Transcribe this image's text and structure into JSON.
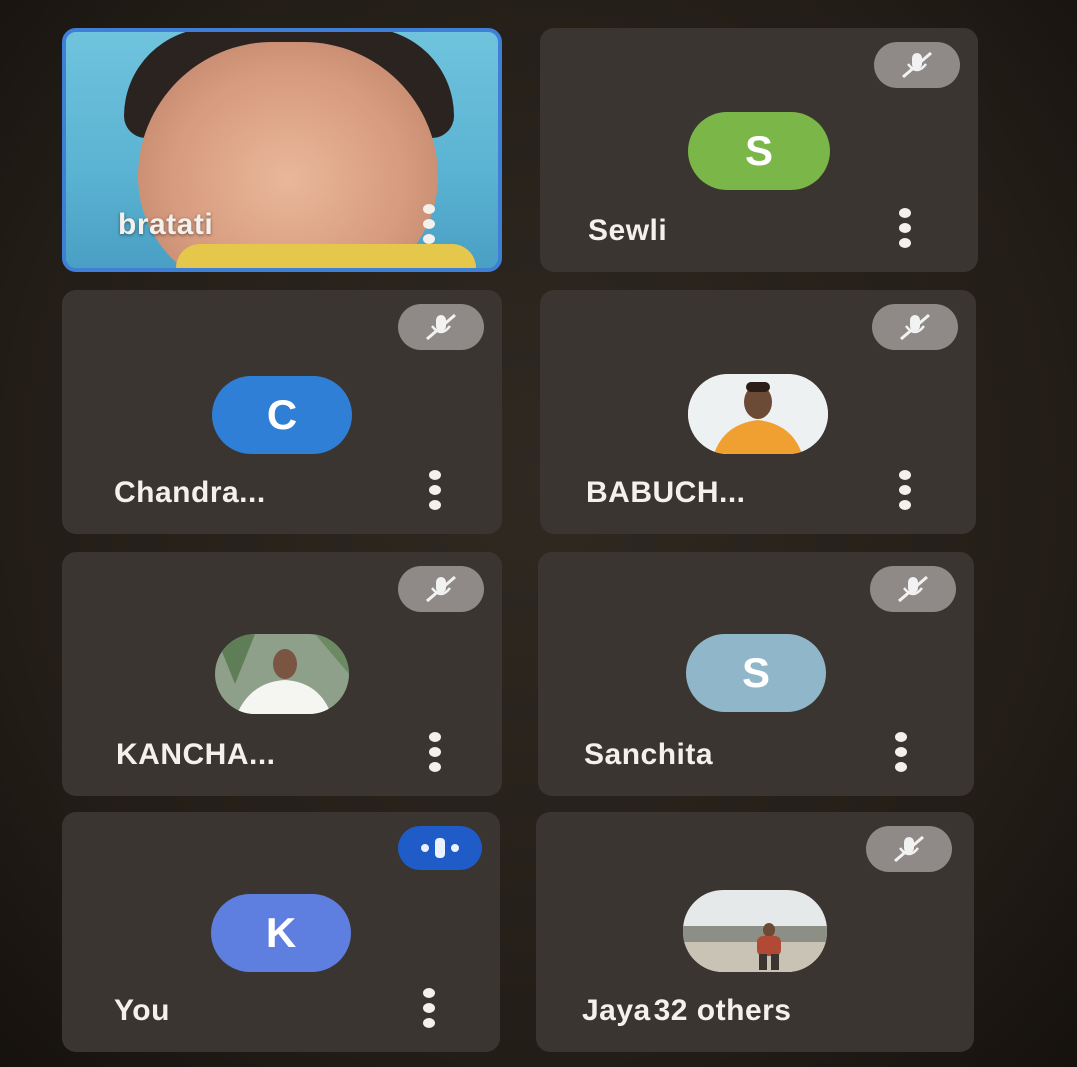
{
  "participants": [
    {
      "name": "bratati",
      "state": "video",
      "avatar_initial": ""
    },
    {
      "name": "Sewli",
      "state": "muted",
      "avatar_initial": "S",
      "avatar_color": "#7ab648"
    },
    {
      "name": "Chandra...",
      "state": "muted",
      "avatar_initial": "C",
      "avatar_color": "#2f7fd6"
    },
    {
      "name": "BABUCH...",
      "state": "muted",
      "avatar_initial": ""
    },
    {
      "name": "KANCHA...",
      "state": "muted",
      "avatar_initial": ""
    },
    {
      "name": "Sanchita",
      "state": "muted",
      "avatar_initial": "S",
      "avatar_color": "#8fb6c9"
    },
    {
      "name": "You",
      "state": "speaking",
      "avatar_initial": "K",
      "avatar_color": "#5e7fe0"
    },
    {
      "name": "Jaya",
      "state": "muted",
      "avatar_initial": ""
    }
  ],
  "others_label": "32 others",
  "icons": {
    "mic_off": "mic-off-icon",
    "speaking": "audio-level-icon",
    "more": "more-vert-icon"
  },
  "colors": {
    "active_border": "#3f7fd6",
    "tile_bg": "#3a3530",
    "mute_badge": "#8f8a87",
    "speak_badge": "#1f5cc8"
  }
}
